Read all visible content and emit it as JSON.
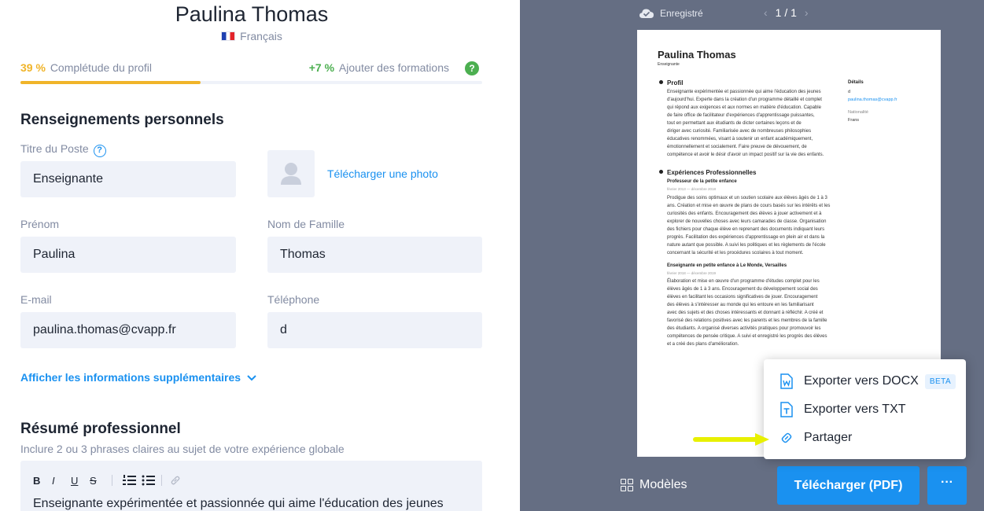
{
  "editor": {
    "full_name": "Paulina Thomas",
    "language": "Français",
    "progress": {
      "percent": "39 %",
      "percent_value": 0.39,
      "label": "Complétude du profil",
      "hint_plus": "+7 %",
      "hint_label": "Ajouter des formations",
      "help": "?"
    },
    "personal": {
      "title": "Renseignements personnels",
      "job_title_label": "Titre du Poste",
      "job_title_help": "?",
      "job_title_value": "Enseignante",
      "upload_photo": "Télécharger une photo",
      "first_name_label": "Prénom",
      "first_name_value": "Paulina",
      "last_name_label": "Nom de Famille",
      "last_name_value": "Thomas",
      "email_label": "E-mail",
      "email_value": "paulina.thomas@cvapp.fr",
      "phone_label": "Téléphone",
      "phone_value": "d",
      "more_info": "Afficher les informations supplémentaires"
    },
    "summary": {
      "title": "Résumé professionnel",
      "subtitle": "Inclure 2 ou 3 phrases claires au sujet de votre expérience globale",
      "toolbar": {
        "bold": "B",
        "italic": "I",
        "underline": "U",
        "strike": "S"
      },
      "text": "Enseignante expérimentée et passionnée qui aime l'éducation des jeunes"
    }
  },
  "preview": {
    "saved": "Enregistré",
    "page": "1 / 1",
    "models": "Modèles",
    "download": "Télécharger (PDF)",
    "more": "···",
    "cv": {
      "name": "Paulina Thomas",
      "job": "Enseignante",
      "profile_title": "Profil",
      "profile_text": [
        "Enseignante expérimentée et passionnée qui aime l'éducation des jeunes",
        "d'aujourd'hui. Experte dans la création d'un programme détaillé et complet",
        "qui répond aux exigences et aux normes en matière d'éducation. Capable",
        "de faire office de facilitateur d'expériences d'apprentissage puissantes,",
        "tout en permettant aux étudiants de dicter certaines leçons et de",
        "diriger avec curiosité. Familiarisée avec de nombreuses philosophies",
        "éducatives renommées, visant à soutenir un enfant académiquement,",
        "émotionnellement et socialement. Faire preuve de dévouement, de",
        "compétence et avoir le désir d'avoir un impact positif sur la vie des enfants."
      ],
      "exp_title": "Expériences Professionnelles",
      "job1_title": "Professeur de la petite enfance",
      "job1_date": "février 2013 — décembre 2018",
      "job1_text": [
        " Prodigue des soins optimaux et un soutien scolaire aux élèves âgés de 1 à 3",
        "ans. Création et mise en œuvre de plans de cours basés sur les intérêts et les",
        "curiosités des enfants. Encouragement des élèves à jouer activement et à",
        "explorer de nouvelles choses avec leurs camarades de classe. Organisation",
        "des fichiers pour chaque élève en reprenant des documents indiquant leurs",
        "progrès. Facilitation des expériences d'apprentissage en plein air et dans la",
        "nature autant que possible. A suivi les politiques et les règlements de l'école",
        "concernant la sécurité et les procédures scolaires à tout moment."
      ],
      "job2_title": "Enseignante en petite enfance à Le Monde, Versailles",
      "job2_date": "février 2018 — décembre 2019",
      "job2_text": [
        " Élaboration et mise en œuvre d'un programme d'études complet pour les",
        "élèves âgés de 1 à 3 ans. Encouragement du développement social des",
        "élèves en facilitant les occasions significatives de jouer. Encouragement",
        "des élèves à s'intéresser au monde qui les entoure en les familiarisant",
        "avec des sujets et des choses intéressants et donnant à réfléchir. A créé et",
        "favorisé des relations positives avec les parents et les membres de la famille",
        "des étudiants. A organisé diverses activités pratiques pour promouvoir les",
        "compétences de pensée critique. A suivi et enregistré les progrès des élèves",
        "et a créé des plans d'amélioration."
      ],
      "details_title": "Détails",
      "details_phone": "d",
      "details_email": "paulina.thomas@cvapp.fr",
      "nationality_label": "Nationalité",
      "nationality_value": "Frans"
    }
  },
  "menu": {
    "export_docx": "Exporter vers DOCX",
    "beta": "BETA",
    "export_txt": "Exporter vers TXT",
    "share": "Partager"
  },
  "colors": {
    "accent": "#1a91f0",
    "progress": "#f0b429",
    "green": "#4caf50",
    "preview_bg": "#656e83",
    "field_bg": "#eff2f9",
    "highlight_arrow": "#e8f000"
  }
}
